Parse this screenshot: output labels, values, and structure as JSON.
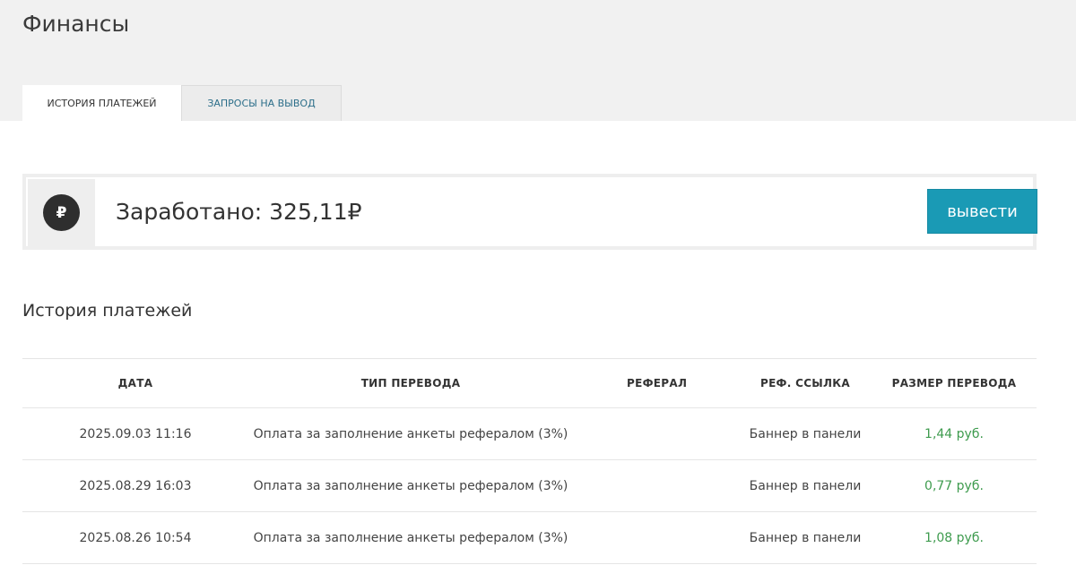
{
  "page": {
    "title": "Финансы"
  },
  "tabs": [
    {
      "label": "История платежей",
      "active": true
    },
    {
      "label": "Запросы на вывод",
      "active": false
    }
  ],
  "earned": {
    "icon": "ruble-icon",
    "icon_glyph": "₽",
    "text": "Заработано: 325,11₽",
    "button_label": "вывести",
    "button_color": "#1a9ab5"
  },
  "history": {
    "title": "История платежей",
    "columns": [
      "Дата",
      "Тип перевода",
      "Реферал",
      "Реф. ссылка",
      "Размер перевода"
    ],
    "rows": [
      {
        "date": "2025.09.03 11:16",
        "type": "Оплата за заполнение анкеты рефералом (3%)",
        "referral": "",
        "ref_link": "Баннер в панели",
        "amount": "1,44 руб."
      },
      {
        "date": "2025.08.29 16:03",
        "type": "Оплата за заполнение анкеты рефералом (3%)",
        "referral": "",
        "ref_link": "Баннер в панели",
        "amount": "0,77 руб."
      },
      {
        "date": "2025.08.26 10:54",
        "type": "Оплата за заполнение анкеты рефералом (3%)",
        "referral": "",
        "ref_link": "Баннер в панели",
        "amount": "1,08 руб."
      }
    ],
    "amount_color": "#3e9b4e"
  }
}
